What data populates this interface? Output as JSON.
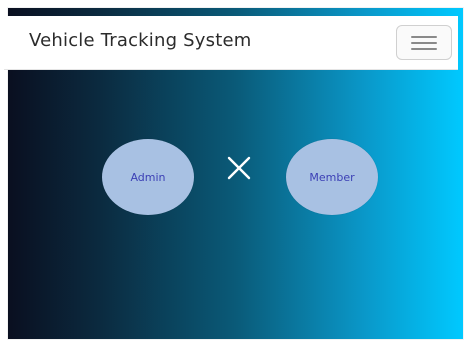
{
  "navbar": {
    "brand": "Vehicle Tracking System",
    "menu_icon": "hamburger-menu-icon"
  },
  "main": {
    "admin_label": "Admin",
    "member_label": "Member",
    "separator_icon": "close-x-icon"
  },
  "colors": {
    "gradient_start": "#0a0f20",
    "gradient_end": "#00c9ff",
    "circle_fill": "#a8c1e3",
    "circle_text": "#3b3fb5"
  }
}
